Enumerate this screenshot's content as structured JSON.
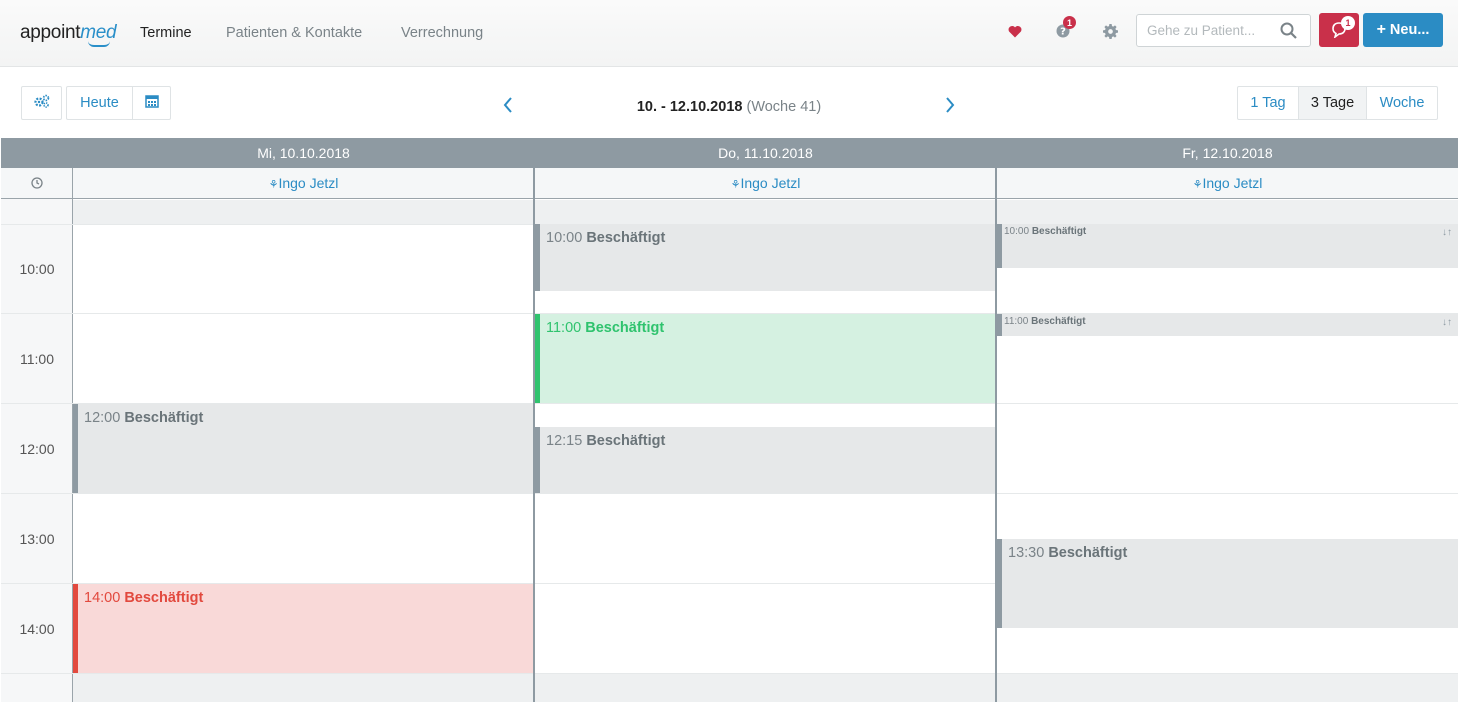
{
  "app": {
    "logo_a": "appoint",
    "logo_b": "med"
  },
  "nav": {
    "items": [
      "Termine",
      "Patienten & Kontakte",
      "Verrechnung"
    ]
  },
  "header": {
    "help_badge": "1",
    "msg_badge": "1",
    "search_placeholder": "Gehe zu Patient...",
    "new_label": "Neu...",
    "accent": "#2b8cc4",
    "alert": "#c9304a"
  },
  "toolbar": {
    "today_label": "Heute",
    "range_dates": "10. - 12.10.2018",
    "range_week": "(Woche 41)",
    "views": [
      "1 Tag",
      "3 Tage",
      "Woche"
    ],
    "selected_view": "3 Tage"
  },
  "calendar": {
    "days": [
      "Mi, 10.10.2018",
      "Do, 11.10.2018",
      "Fr, 12.10.2018"
    ],
    "resources": [
      "Ingo Jetzl",
      "Ingo Jetzl",
      "Ingo Jetzl"
    ],
    "hours": [
      "10:00",
      "11:00",
      "12:00",
      "13:00",
      "14:00"
    ],
    "events": [
      {
        "time": "12:00",
        "title": "Beschäftigt"
      },
      {
        "time": "14:00",
        "title": "Beschäftigt"
      },
      {
        "time": "10:00",
        "title": "Beschäftigt"
      },
      {
        "time": "11:00",
        "title": "Beschäftigt"
      },
      {
        "time": "12:15",
        "title": "Beschäftigt"
      },
      {
        "time": "10:00",
        "title": "Beschäftigt"
      },
      {
        "time": "11:00",
        "title": "Beschäftigt"
      },
      {
        "time": "13:30",
        "title": "Beschäftigt"
      }
    ]
  }
}
